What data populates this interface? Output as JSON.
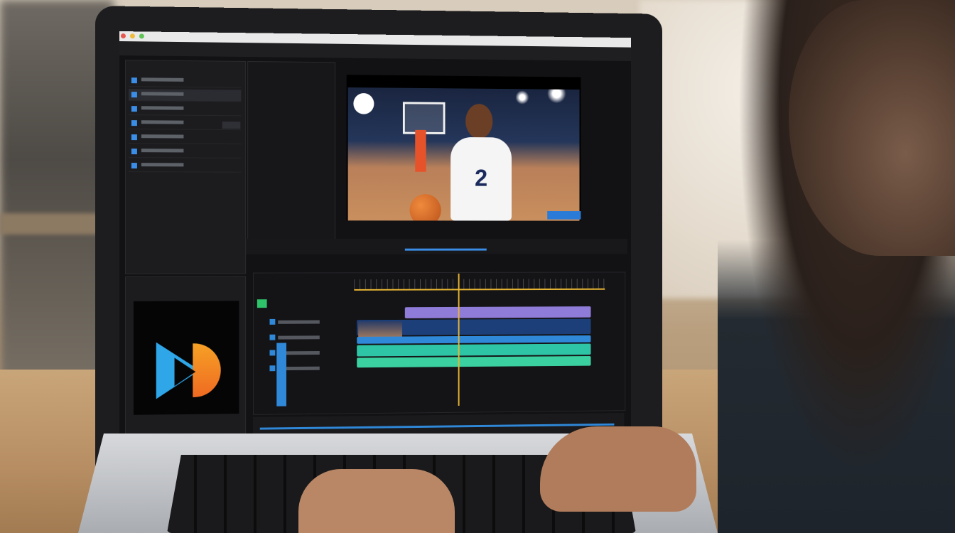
{
  "screen": {
    "app": "video-editor",
    "preview_label_number": "2",
    "colors": {
      "accent_blue": "#2f88d8",
      "playhead_yellow": "#e7b533",
      "clip_purple": "#8f7bd8",
      "clip_teal": "#2ec4a6",
      "logo_blue": "#2fa6e8",
      "logo_orange": "#f6a125"
    },
    "icons": [
      "play-logo-icon",
      "basketball-icon",
      "hoop-icon"
    ]
  }
}
